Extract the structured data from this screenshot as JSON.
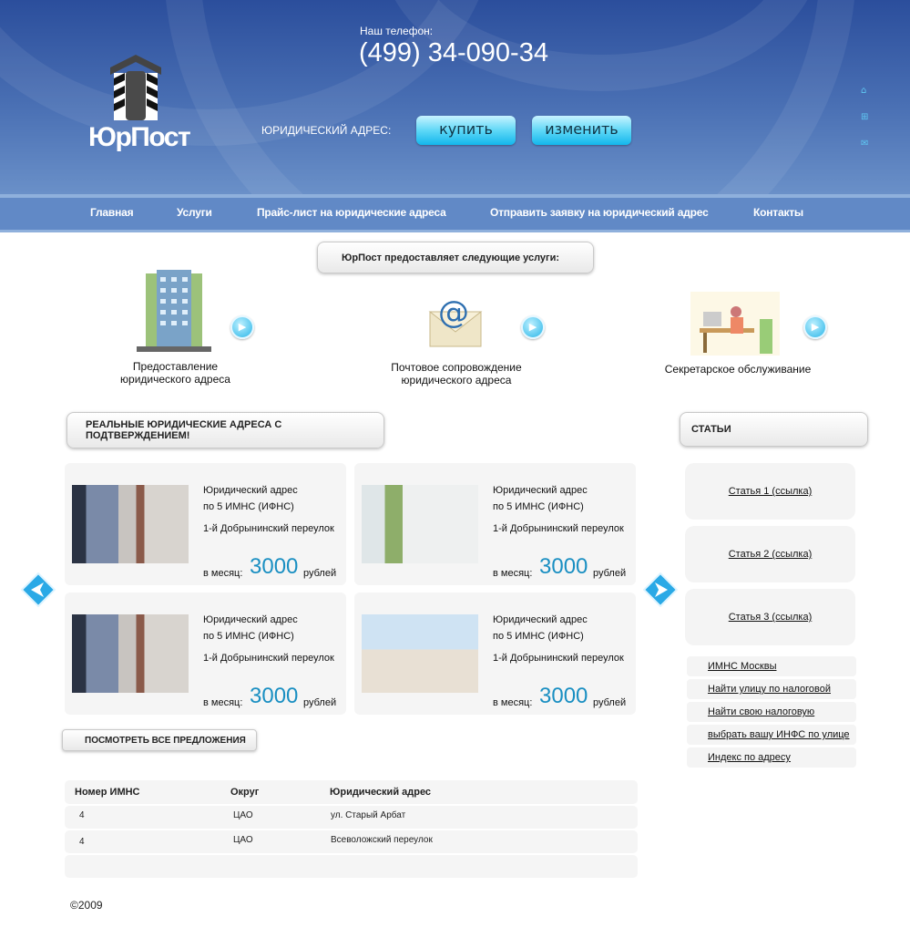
{
  "header": {
    "logo_text": "ЮрПост",
    "phone_label": "Наш телефон:",
    "phone": "(499) 34-090-34",
    "address_label": "ЮРИДИЧЕСКИЙ АДРЕС:",
    "buy_button": "купить",
    "change_button": "изменить",
    "side_icons": [
      "home-icon",
      "sitemap-icon",
      "mail-icon"
    ]
  },
  "nav": {
    "items": [
      "Главная",
      "Услуги",
      "Прайс-лист на юридические адреса",
      "Отправить заявку на юридический адрес",
      "Контакты"
    ]
  },
  "services": {
    "title": "ЮрПост предоставляет следующие услуги:",
    "items": [
      {
        "label": "Предоставление юридического адреса",
        "icon": "building-icon"
      },
      {
        "label": "Почтовое сопровождение юридического адреса",
        "icon": "email-envelope-icon"
      },
      {
        "label": "Секретарское обслуживание",
        "icon": "secretary-icon"
      }
    ]
  },
  "offers": {
    "title": "РЕАЛЬНЫЕ ЮРИДИЧЕСКИЕ АДРЕСА С ПОДТВЕРЖДЕНИЕМ!",
    "per_month": "в месяц:",
    "currency": "рублей",
    "view_all": "ПОСМОТРЕТЬ ВСЕ ПРЕДЛОЖЕНИЯ",
    "cards": [
      {
        "line1": "Юридический адрес",
        "line2": "по 5 ИМНС (ИФНС)",
        "street": "1-й Добрынинский переулок",
        "price": "3000"
      },
      {
        "line1": "Юридический адрес",
        "line2": "по 5 ИМНС (ИФНС)",
        "street": "1-й Добрынинский переулок",
        "price": "3000"
      },
      {
        "line1": "Юридический адрес",
        "line2": "по 5 ИМНС (ИФНС)",
        "street": "1-й Добрынинский переулок",
        "price": "3000"
      },
      {
        "line1": "Юридический адрес",
        "line2": "по 5 ИМНС (ИФНС)",
        "street": "1-й Добрынинский переулок",
        "price": "3000"
      }
    ]
  },
  "articles": {
    "title": "СТАТЬИ",
    "items": [
      "Статья 1 (ссылка)",
      "Статья 2 (ссылка)",
      "Статья 3 (ссылка)"
    ],
    "links": [
      "ИМНС Москвы",
      "Найти улицу по налоговой",
      "Найти свою налоговую",
      "выбрать вашу ИНФС по улице",
      "Индекс по адресу"
    ]
  },
  "table": {
    "headers": [
      "Номер ИМНС",
      "Округ",
      "Юридический адрес"
    ],
    "rows": [
      [
        "4",
        "ЦАО",
        "ул. Старый Арбат"
      ],
      [
        "4",
        "ЦАО",
        "Всеволожский переулок"
      ]
    ]
  },
  "footer": {
    "copyright": "©2009"
  },
  "colors": {
    "header_blue": "#2b4e9c",
    "nav_blue": "#6189c6",
    "price": "#1a8fc2",
    "button_cyan": "#13b7ec"
  }
}
